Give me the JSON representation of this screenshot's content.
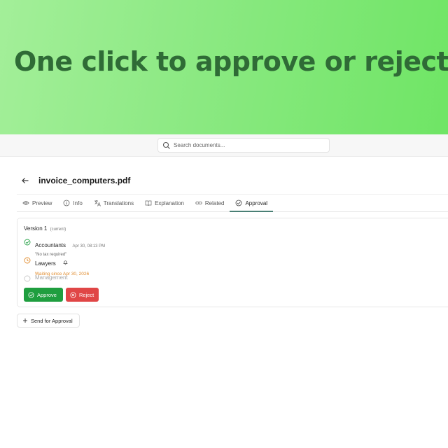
{
  "hero": {
    "title": "One click to approve or reject"
  },
  "search": {
    "placeholder": "Search documents..."
  },
  "document": {
    "filename": "invoice_computers.pdf"
  },
  "tabs": [
    {
      "label": "Preview",
      "icon": "eye-icon"
    },
    {
      "label": "Info",
      "icon": "info-icon"
    },
    {
      "label": "Translations",
      "icon": "translate-icon"
    },
    {
      "label": "Explanation",
      "icon": "book-icon"
    },
    {
      "label": "Related",
      "icon": "link-icon"
    },
    {
      "label": "Approval",
      "icon": "check-circle-icon",
      "active": true
    }
  ],
  "approval": {
    "version_label": "Version 1",
    "version_sub": "(current)",
    "steps": [
      {
        "name": "Accountants",
        "status": "approved",
        "date": "Apr 30, 08:13 PM",
        "note": "\"No tax required\""
      },
      {
        "name": "Lawyers",
        "status": "pending",
        "waiting": "Waiting since Apr 30, 2026"
      },
      {
        "name": "Management",
        "status": "inactive"
      }
    ],
    "approve_label": "Approve",
    "reject_label": "Reject"
  },
  "send_label": "Send for Approval",
  "colors": {
    "hero_gradient_start": "#a3ef99",
    "hero_gradient_end": "#6fe565",
    "hero_text": "#2f6b36",
    "approve": "#1f9e3f",
    "reject": "#e04646",
    "pending": "#e08a2a",
    "active_tab_underline": "#4a7f75"
  }
}
